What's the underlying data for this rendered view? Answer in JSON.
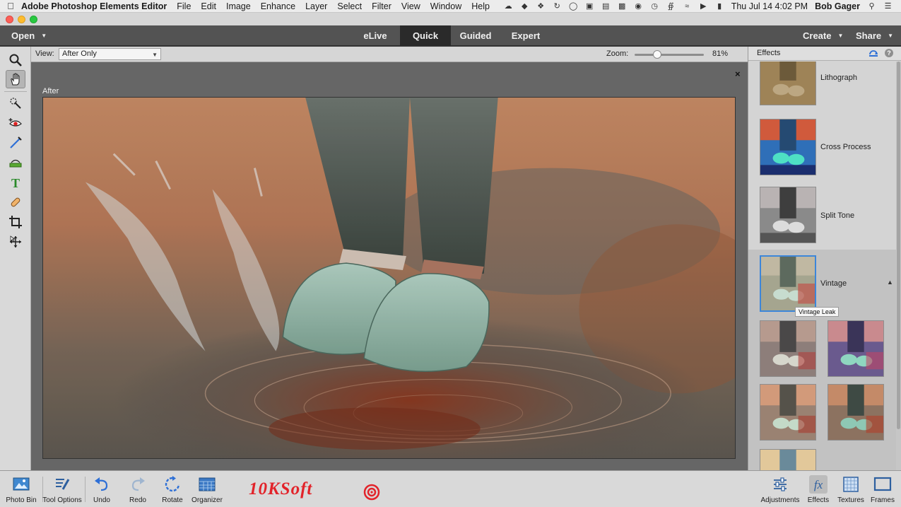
{
  "menubar": {
    "app_name": "Adobe Photoshop Elements Editor",
    "items": [
      "File",
      "Edit",
      "Image",
      "Enhance",
      "Layer",
      "Select",
      "Filter",
      "View",
      "Window",
      "Help"
    ],
    "clock": "Thu Jul 14  4:02 PM",
    "user": "Bob Gager"
  },
  "modebar": {
    "open_label": "Open",
    "tabs": [
      "eLive",
      "Quick",
      "Guided",
      "Expert"
    ],
    "active_tab": "Quick",
    "create_label": "Create",
    "share_label": "Share"
  },
  "options": {
    "view_label": "View:",
    "view_value": "After Only",
    "zoom_label": "Zoom:",
    "zoom_value": "81%",
    "zoom_fraction": 0.33
  },
  "canvas": {
    "close_symbol": "×",
    "view_caption": "After"
  },
  "effects": {
    "title": "Effects",
    "items": [
      {
        "label": "Lithograph"
      },
      {
        "label": "Cross Process"
      },
      {
        "label": "Split Tone"
      },
      {
        "label": "Vintage",
        "selected": true
      }
    ],
    "tooltip": "Vintage Leak"
  },
  "bottombar": {
    "left_buttons": [
      "Photo Bin",
      "Tool Options",
      "Undo",
      "Redo",
      "Rotate",
      "Organizer"
    ],
    "right_buttons": [
      "Adjustments",
      "Effects",
      "Textures",
      "Frames"
    ],
    "active_right": "Effects"
  },
  "watermark": {
    "text": "10KSoft"
  },
  "colors": {
    "accent": "#3c86d9",
    "mode_active_bg": "#2a2a2a",
    "watermark": "#e2232a"
  }
}
